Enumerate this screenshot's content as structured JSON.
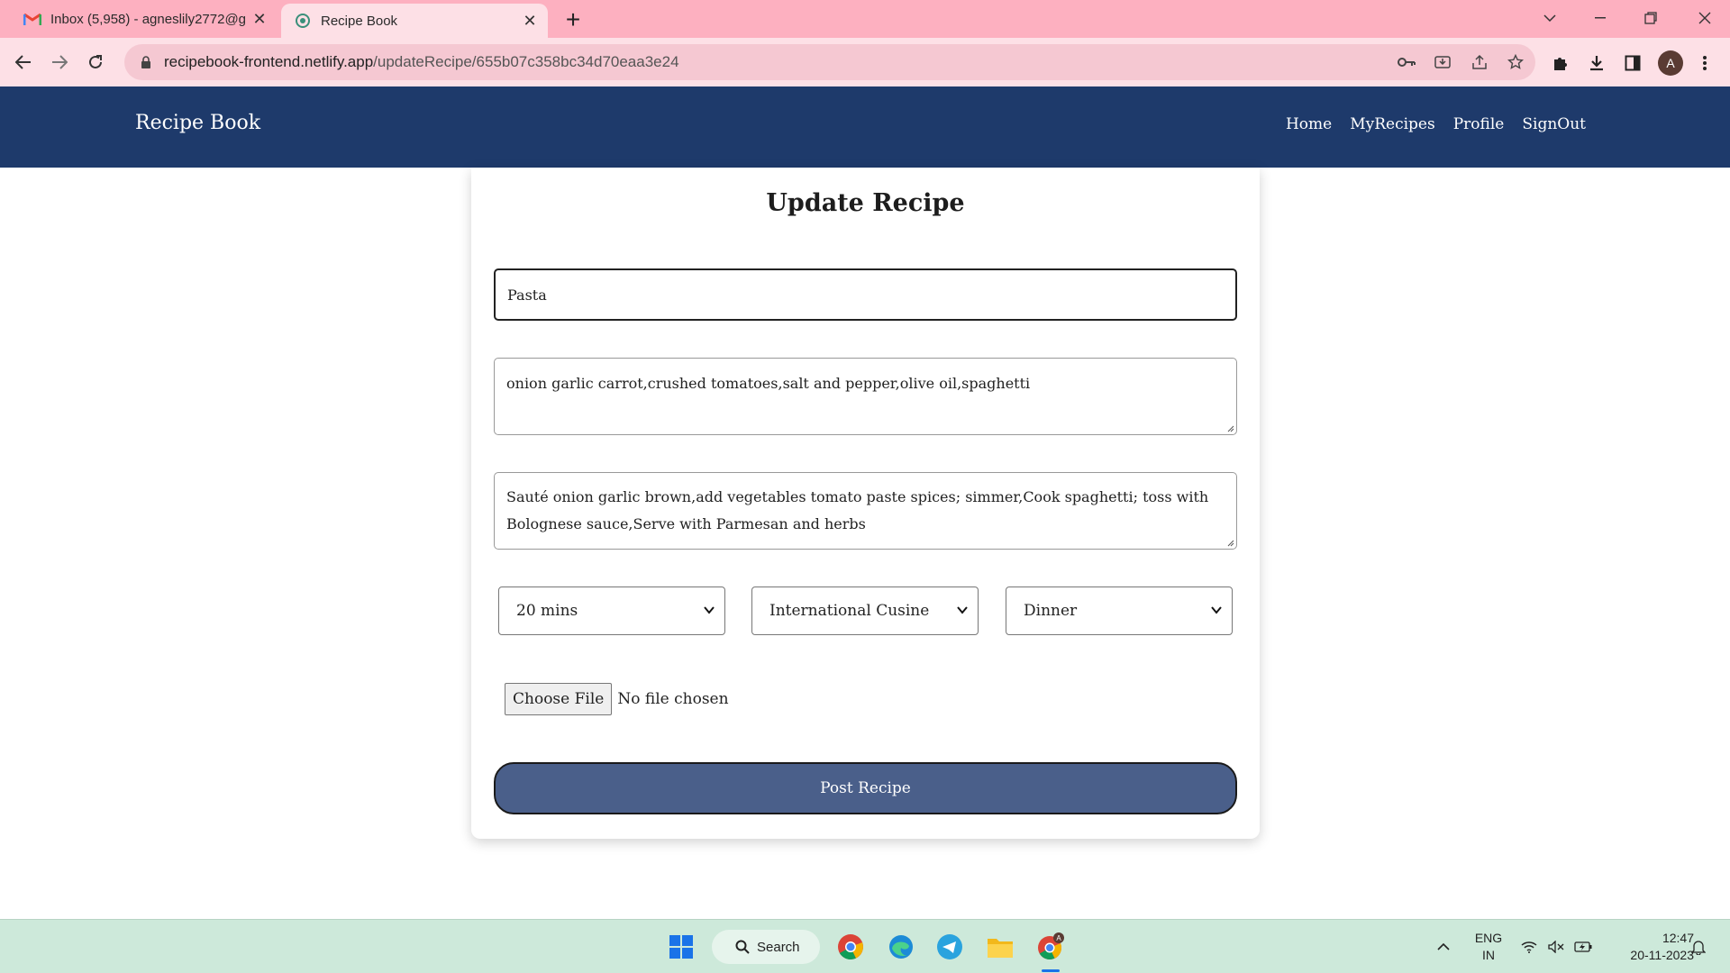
{
  "browser": {
    "tabs": [
      {
        "title": "Inbox (5,958) - agneslily2772@g",
        "icon": "gmail-icon",
        "active": false
      },
      {
        "title": "Recipe Book",
        "icon": "netlify-site-icon",
        "active": true
      }
    ],
    "url_domain": "recipebook-frontend.netlify.app",
    "url_path": "/updateRecipe/655b07c358bc34d70eaa3e24",
    "profile_initial": "A"
  },
  "app": {
    "brand": "Recipe Book",
    "nav": [
      "Home",
      "MyRecipes",
      "Profile",
      "SignOut"
    ],
    "header_color": "#1e3a6b"
  },
  "form": {
    "heading": "Update Recipe",
    "title_value": "Pasta",
    "ingredients_value": "onion garlic carrot,crushed tomatoes,salt and pepper,olive oil,spaghetti",
    "steps_value": "Sauté onion garlic brown,add vegetables tomato paste spices; simmer,Cook spaghetti; toss with Bolognese sauce,Serve with Parmesan and herbs",
    "time_selected": "20 mins",
    "cuisine_selected": "International Cusine",
    "meal_selected": "Dinner",
    "file_button": "Choose File",
    "file_status": "No file chosen",
    "submit_label": "Post Recipe",
    "submit_color": "#4a5f8a"
  },
  "taskbar": {
    "search_label": "Search",
    "lang_line1": "ENG",
    "lang_line2": "IN",
    "time": "12:47",
    "date": "20-11-2023"
  }
}
